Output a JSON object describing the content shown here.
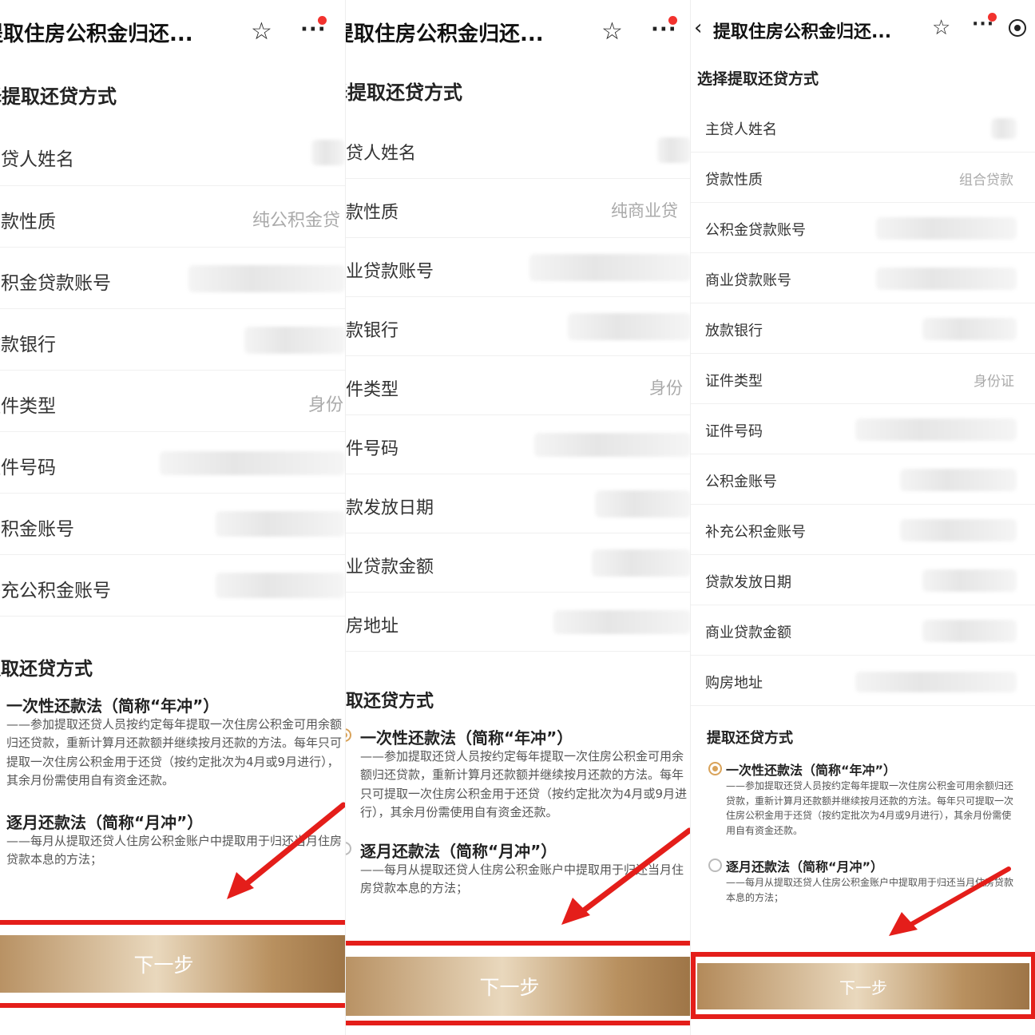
{
  "common": {
    "title": "提取住房公积金归还...",
    "select_heading": "选择提取还贷方式",
    "method_heading": "提取还贷方式",
    "next_label": "下一步"
  },
  "panels": [
    {
      "heading": "择提取还贷方式",
      "rows": [
        {
          "label": "主贷人姓名",
          "value": ""
        },
        {
          "label": "贷款性质",
          "value": "纯公积金贷"
        },
        {
          "label": "公积金贷款账号",
          "value": ""
        },
        {
          "label": "放款银行",
          "value": ""
        },
        {
          "label": "证件类型",
          "value": "身份"
        },
        {
          "label": "证件号码",
          "value": ""
        },
        {
          "label": "公积金账号",
          "value": ""
        },
        {
          "label": "补充公积金账号",
          "value": ""
        }
      ],
      "method_heading": "提取还贷方式"
    },
    {
      "heading": "择提取还贷方式",
      "rows": [
        {
          "label": "主贷人姓名",
          "value": ""
        },
        {
          "label": "贷款性质",
          "value": "纯商业贷"
        },
        {
          "label": "商业贷款账号",
          "value": ""
        },
        {
          "label": "放款银行",
          "value": ""
        },
        {
          "label": "证件类型",
          "value": "身份"
        },
        {
          "label": "证件号码",
          "value": ""
        },
        {
          "label": "贷款发放日期",
          "value": ""
        },
        {
          "label": "商业贷款金额",
          "value": ""
        },
        {
          "label": "购房地址",
          "value": ""
        }
      ],
      "method_heading": "提取还贷方式"
    },
    {
      "heading": "选择提取还贷方式",
      "rows": [
        {
          "label": "主贷人姓名",
          "value": ""
        },
        {
          "label": "贷款性质",
          "value": "组合贷款"
        },
        {
          "label": "公积金贷款账号",
          "value": ""
        },
        {
          "label": "商业贷款账号",
          "value": ""
        },
        {
          "label": "放款银行",
          "value": ""
        },
        {
          "label": "证件类型",
          "value": "身份证"
        },
        {
          "label": "证件号码",
          "value": ""
        },
        {
          "label": "公积金账号",
          "value": ""
        },
        {
          "label": "补充公积金账号",
          "value": ""
        },
        {
          "label": "贷款发放日期",
          "value": ""
        },
        {
          "label": "商业贷款金额",
          "value": ""
        },
        {
          "label": "购房地址",
          "value": ""
        }
      ],
      "method_heading": "提取还贷方式"
    }
  ],
  "methods": [
    {
      "name": "一次性还款法（简称“年冲”）",
      "desc": "——参加提取还贷人员按约定每年提取一次住房公积金可用余额归还贷款，重新计算月还款额并继续按月还款的方法。每年只可提取一次住房公积金用于还贷（按约定批次为4月或9月进行），其余月份需使用自有资金还款。"
    },
    {
      "name": "逐月还款法（简称“月冲”）",
      "desc": "——每月从提取还贷人住房公积金账户中提取用于归还当月住房贷款本息的方法；"
    }
  ],
  "colors": {
    "accent": "#d9a35a",
    "highlight": "#e41e1a",
    "button_gold": "#b8905f"
  }
}
